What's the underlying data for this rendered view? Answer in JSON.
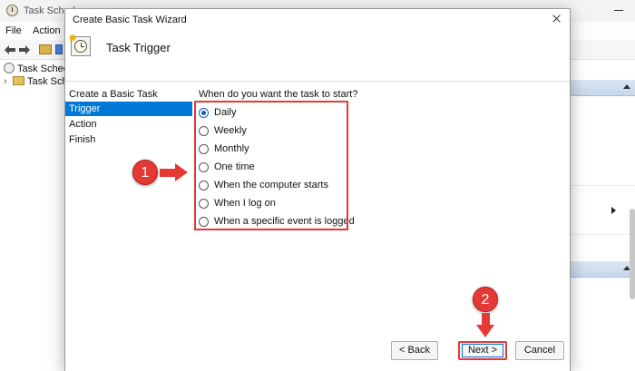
{
  "background_app": {
    "title": "Task Schedu",
    "menu": [
      "File",
      "Action"
    ],
    "tree": [
      {
        "label": "Task Schedu"
      },
      {
        "label": "Task Sche"
      }
    ]
  },
  "dialog": {
    "title": "Create Basic Task Wizard",
    "header_title": "Task Trigger",
    "nav": [
      {
        "label": "Create a Basic Task",
        "selected": false
      },
      {
        "label": "Trigger",
        "selected": true
      },
      {
        "label": "Action",
        "selected": false
      },
      {
        "label": "Finish",
        "selected": false
      }
    ],
    "question": "When do you want the task to start?",
    "options": [
      {
        "label": "Daily",
        "checked": true
      },
      {
        "label": "Weekly",
        "checked": false
      },
      {
        "label": "Monthly",
        "checked": false
      },
      {
        "label": "One time",
        "checked": false
      },
      {
        "label": "When the computer starts",
        "checked": false
      },
      {
        "label": "When I log on",
        "checked": false
      },
      {
        "label": "When a specific event is logged",
        "checked": false
      }
    ],
    "buttons": {
      "back": "< Back",
      "next": "Next >",
      "cancel": "Cancel"
    }
  },
  "annotations": {
    "step1": "1",
    "step2": "2",
    "color": "#e53935"
  },
  "colors": {
    "selection": "#0078d7",
    "radio_checked": "#0f5fbd"
  }
}
